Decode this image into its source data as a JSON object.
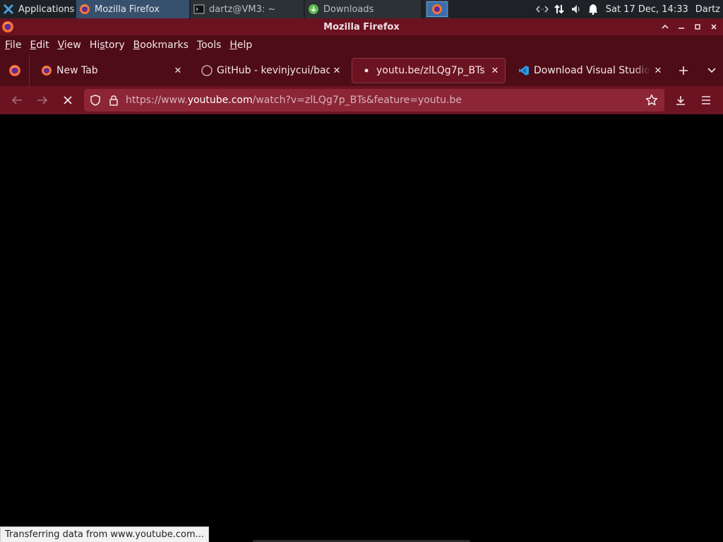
{
  "panel": {
    "applications_label": "Applications",
    "tasks": [
      {
        "label": "Mozilla Firefox",
        "icon": "firefox-icon"
      },
      {
        "label": "dartz@VM3: ~",
        "icon": "terminal-icon"
      },
      {
        "label": "Downloads",
        "icon": "download-icon"
      }
    ],
    "clock": "Sat 17 Dec, 14:33",
    "user": "Dartz"
  },
  "window": {
    "title": "Mozilla Firefox"
  },
  "menubar": {
    "items": [
      {
        "label": "File",
        "accel": "F",
        "rest": "ile"
      },
      {
        "label": "Edit",
        "accel": "E",
        "rest": "dit"
      },
      {
        "label": "View",
        "accel": "V",
        "rest": "iew"
      },
      {
        "label": "History",
        "pre": "Hi",
        "accel": "s",
        "rest": "tory"
      },
      {
        "label": "Bookmarks",
        "accel": "B",
        "rest": "ookmarks"
      },
      {
        "label": "Tools",
        "accel": "T",
        "rest": "ools"
      },
      {
        "label": "Help",
        "accel": "H",
        "rest": "elp"
      }
    ]
  },
  "tabs": [
    {
      "label": "New Tab",
      "icon": "firefox-icon",
      "active": false
    },
    {
      "label": "GitHub - kevinjycui/bad-a",
      "icon": "github-icon",
      "active": false
    },
    {
      "label": "youtu.be/zlLQg7p_BTs",
      "icon": "loading-dot-icon",
      "active": true
    },
    {
      "label": "Download Visual Studio C",
      "icon": "vscode-icon",
      "active": false
    }
  ],
  "urlbar": {
    "prefix": "https://www.",
    "domain": "youtube.com",
    "suffix": "/watch?v=zlLQg7p_BTs&feature=youtu.be"
  },
  "status_text": "Transferring data from www.youtube.com...",
  "colors": {
    "titlebar": "#6b1220",
    "toolbar": "#4e0c17",
    "navbar": "#6c1322",
    "urlbar": "#8c2636",
    "content": "#000000"
  }
}
